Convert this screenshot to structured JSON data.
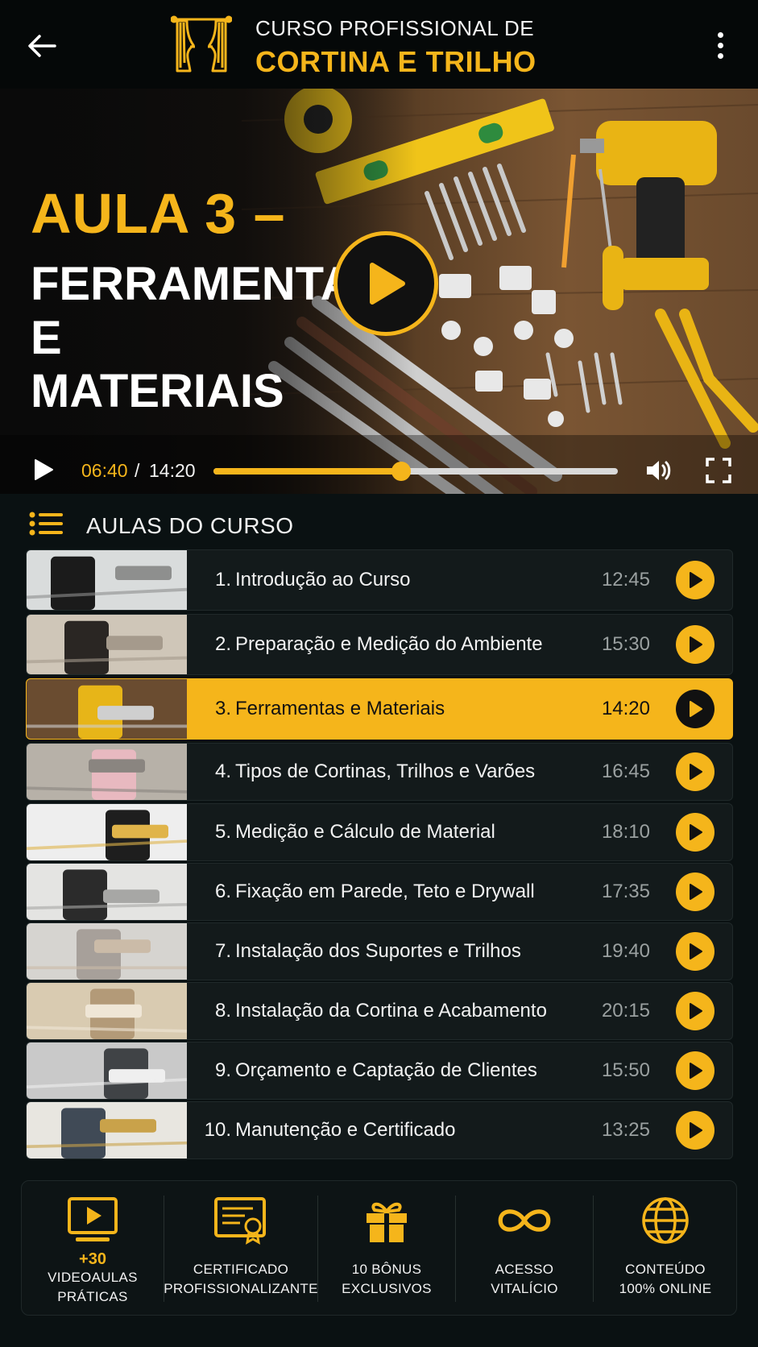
{
  "header": {
    "brand_line1": "CURSO PROFISSIONAL DE",
    "brand_line2": "CORTINA E TRILHO"
  },
  "video": {
    "title_line1": "AULA 3 –",
    "title_line2": "FERRAMENTAS E MATERIAIS",
    "current_time": "06:40",
    "separator": "/",
    "total_time": "14:20",
    "progress": 0.465
  },
  "lessons_section": {
    "title": "AULAS DO CURSO"
  },
  "lessons": [
    {
      "num": "1.",
      "title": "Introdução ao Curso",
      "duration": "12:45",
      "active": false
    },
    {
      "num": "2.",
      "title": "Preparação e Medição do Ambiente",
      "duration": "15:30",
      "active": false
    },
    {
      "num": "3.",
      "title": "Ferramentas e Materiais",
      "duration": "14:20",
      "active": true
    },
    {
      "num": "4.",
      "title": "Tipos de Cortinas, Trilhos e Varões",
      "duration": "16:45",
      "active": false
    },
    {
      "num": "5.",
      "title": "Medição e Cálculo de Material",
      "duration": "18:10",
      "active": false
    },
    {
      "num": "6.",
      "title": "Fixação em Parede, Teto e Drywall",
      "duration": "17:35",
      "active": false
    },
    {
      "num": "7.",
      "title": "Instalação dos Suportes e Trilhos",
      "duration": "19:40",
      "active": false
    },
    {
      "num": "8.",
      "title": "Instalação da Cortina e Acabamento",
      "duration": "20:15",
      "active": false
    },
    {
      "num": "9.",
      "title": "Orçamento e Captação de Clientes",
      "duration": "15:50",
      "active": false
    },
    {
      "num": "10.",
      "title": "Manutenção e Certificado",
      "duration": "13:25",
      "active": false
    }
  ],
  "features": [
    {
      "highlight": "+30",
      "line1": "VIDEOAULAS",
      "line2": "PRÁTICAS",
      "icon": "video-lesson-icon"
    },
    {
      "highlight": "",
      "line1": "CERTIFICADO",
      "line2": "PROFISSIONALIZANTE",
      "icon": "certificate-icon"
    },
    {
      "highlight": "",
      "line1": "10 BÔNUS",
      "line2": "EXCLUSIVOS",
      "icon": "gift-icon"
    },
    {
      "highlight": "",
      "line1": "ACESSO",
      "line2": "VITALÍCIO",
      "icon": "infinity-icon"
    },
    {
      "highlight": "",
      "line1": "CONTEÚDO",
      "line2": "100% ONLINE",
      "icon": "globe-icon"
    }
  ],
  "colors": {
    "accent": "#f5b51b",
    "background": "#0a1112",
    "row_background": "#131a1b"
  }
}
